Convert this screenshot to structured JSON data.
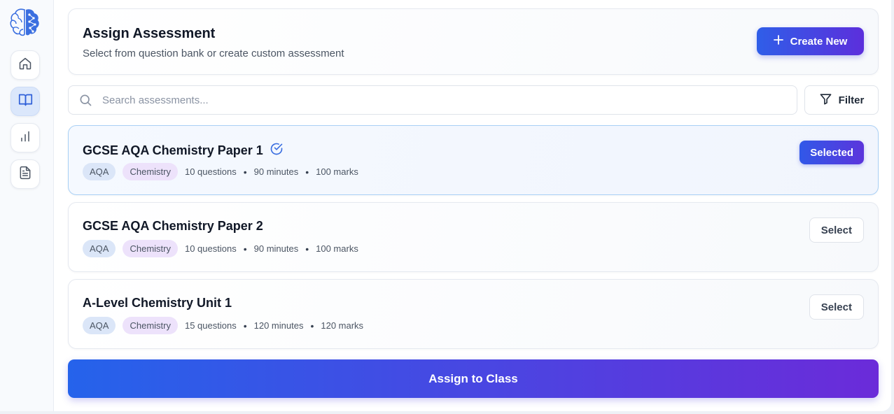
{
  "sidebar": {
    "logo_icon": "brain-icon",
    "items": [
      {
        "icon": "home-icon",
        "active": false
      },
      {
        "icon": "book-open-icon",
        "active": true
      },
      {
        "icon": "bar-chart-icon",
        "active": false
      },
      {
        "icon": "document-icon",
        "active": false
      }
    ]
  },
  "header": {
    "title": "Assign Assessment",
    "subtitle": "Select from question bank or create custom assessment",
    "create_label": "Create New"
  },
  "search": {
    "placeholder": "Search assessments...",
    "value": ""
  },
  "filter": {
    "label": "Filter"
  },
  "assessments": [
    {
      "title": "GCSE AQA Chemistry Paper 1",
      "board": "AQA",
      "subject": "Chemistry",
      "questions": "10 questions",
      "duration": "90 minutes",
      "marks": "100 marks",
      "selected": true,
      "button_label": "Selected"
    },
    {
      "title": "GCSE AQA Chemistry Paper 2",
      "board": "AQA",
      "subject": "Chemistry",
      "questions": "10 questions",
      "duration": "90 minutes",
      "marks": "100 marks",
      "selected": false,
      "button_label": "Select"
    },
    {
      "title": "A-Level Chemistry Unit 1",
      "board": "AQA",
      "subject": "Chemistry",
      "questions": "15 questions",
      "duration": "120 minutes",
      "marks": "120 marks",
      "selected": false,
      "button_label": "Select"
    }
  ],
  "separator": "•",
  "assign_label": "Assign to Class",
  "colors": {
    "accent_start": "#2563eb",
    "accent_end": "#6b2bd9",
    "selected_border": "#a9d0f5",
    "check_icon": "#3b6fe0"
  }
}
